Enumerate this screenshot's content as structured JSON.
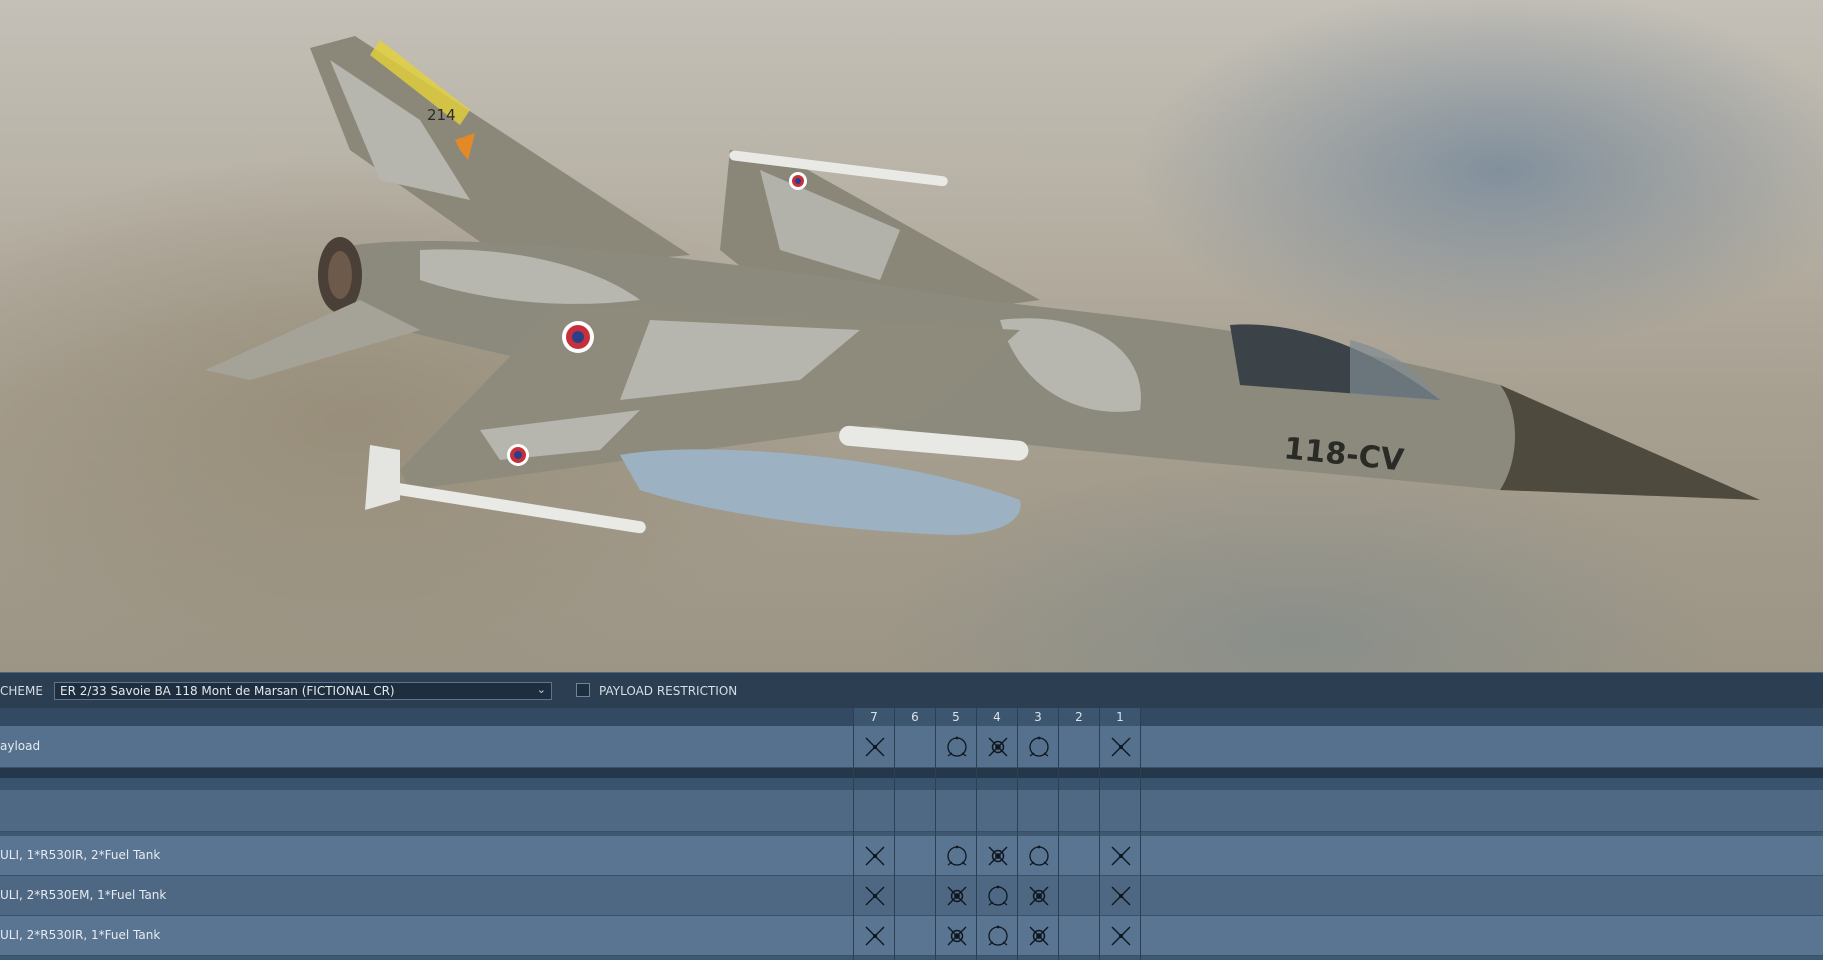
{
  "aircraft": {
    "tail_number": "214",
    "fuselage_code": "118-CV"
  },
  "toolbar": {
    "scheme_label": "CHEME",
    "scheme_value": "ER 2/33 Savoie BA 118 Mont de Marsan (FICTIONAL CR)",
    "restriction_label": "PAYLOAD RESTRICTION",
    "restriction_checked": false
  },
  "stations": [
    "7",
    "6",
    "5",
    "4",
    "3",
    "2",
    "1"
  ],
  "rows": [
    {
      "name": "ayload",
      "cells": [
        "x",
        "",
        "circle",
        "x-dot",
        "circle",
        "",
        "x"
      ]
    },
    {
      "name": "",
      "cells": [
        "",
        "",
        "",
        "",
        "",
        "",
        ""
      ]
    },
    {
      "name": "ULI, 1*R530IR, 2*Fuel Tank",
      "cells": [
        "x",
        "",
        "circle",
        "x-dot",
        "circle",
        "",
        "x"
      ]
    },
    {
      "name": "ULI, 2*R530EM, 1*Fuel Tank",
      "cells": [
        "x",
        "",
        "x-dot",
        "circle",
        "x-dot",
        "",
        "x"
      ]
    },
    {
      "name": "ULI, 2*R530IR, 1*Fuel Tank",
      "cells": [
        "x",
        "",
        "x-dot",
        "circle",
        "x-dot",
        "",
        "x"
      ]
    }
  ],
  "colors": {
    "panel_bg": "#3f5872",
    "toolbar_bg": "#2b3e52",
    "row_light": "#5a7490",
    "row_dark": "#4d6681"
  },
  "icons": {
    "x": "missile-x-icon",
    "circle": "fuel-tank-circle-icon",
    "x-dot": "missile-dot-icon",
    "chevron": "chevron-down-icon"
  }
}
